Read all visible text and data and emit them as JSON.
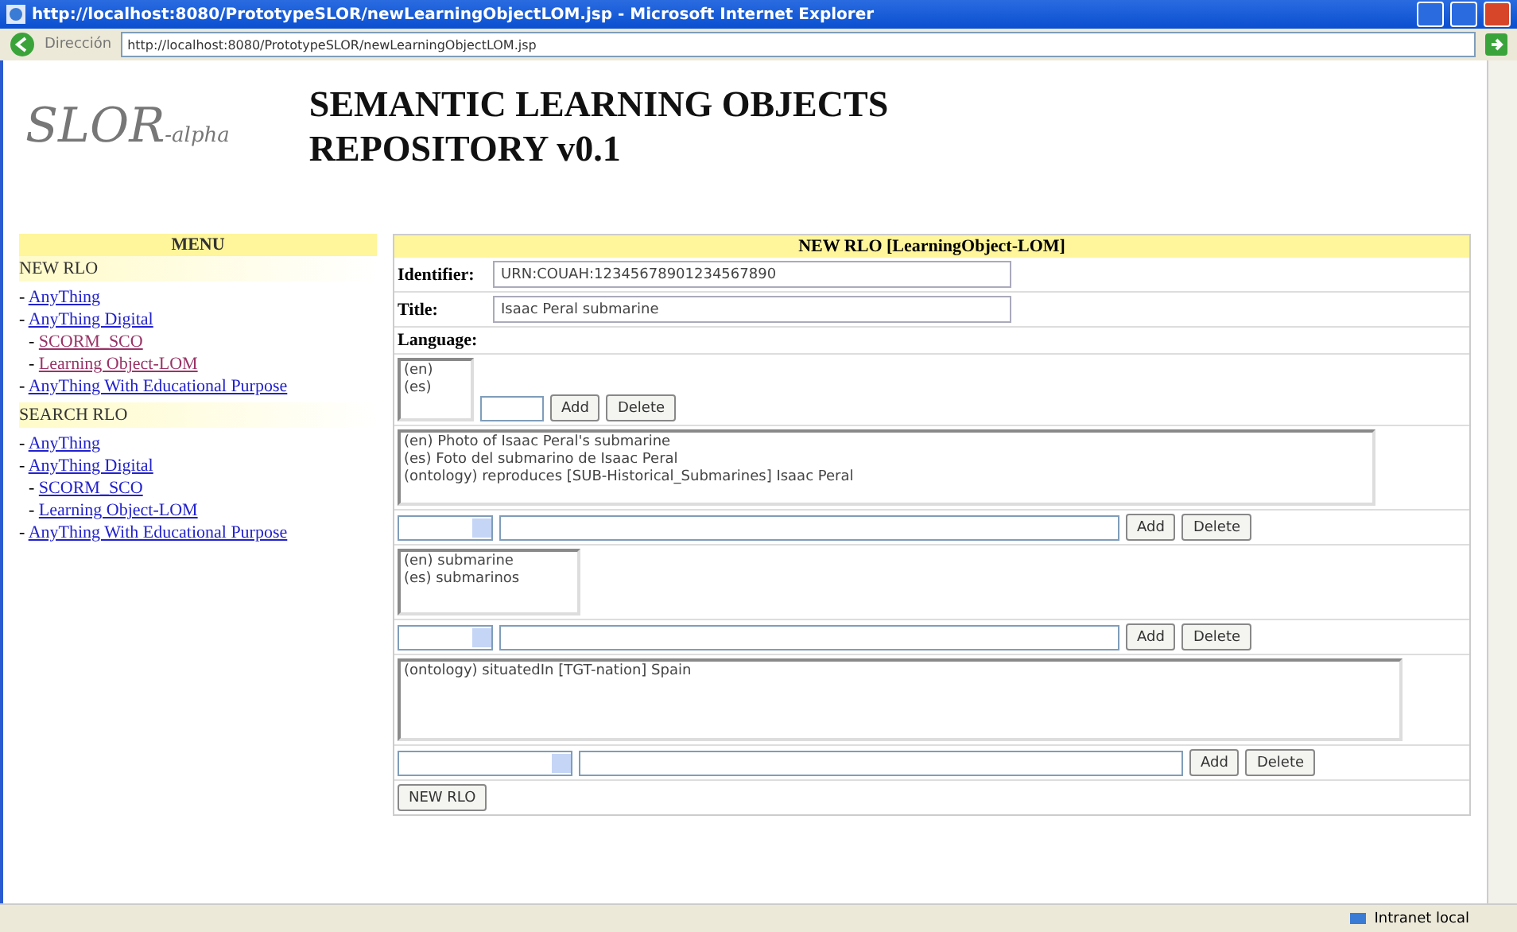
{
  "window": {
    "title": "http://localhost:8080/PrototypeSLOR/newLearningObjectLOM.jsp - Microsoft Internet Explorer"
  },
  "toolbar": {
    "address_label": "Dirección",
    "address": "http://localhost:8080/PrototypeSLOR/newLearningObjectLOM.jsp"
  },
  "logo": {
    "main": "SLOR",
    "suffix": "-alpha"
  },
  "heading": "SEMANTIC LEARNING OBJECTS REPOSITORY v0.1",
  "menu": {
    "title": "MENU",
    "sections": [
      {
        "title": "NEW RLO",
        "links": [
          {
            "bullet": "-",
            "label": "AnyThing",
            "visited": false
          },
          {
            "bullet": "-",
            "label": "AnyThing Digital",
            "visited": false,
            "children": [
              {
                "bullet": "-",
                "label": "SCORM_SCO",
                "visited": true
              },
              {
                "bullet": "-",
                "label": "Learning Object-LOM",
                "visited": true
              }
            ]
          },
          {
            "bullet": "-",
            "label": "AnyThing With Educational Purpose",
            "visited": false
          }
        ]
      },
      {
        "title": "SEARCH RLO",
        "links": [
          {
            "bullet": "-",
            "label": "AnyThing",
            "visited": false
          },
          {
            "bullet": "-",
            "label": "AnyThing Digital",
            "visited": false,
            "children": [
              {
                "bullet": "-",
                "label": "SCORM_SCO",
                "visited": false
              },
              {
                "bullet": "-",
                "label": "Learning Object-LOM",
                "visited": false
              }
            ]
          },
          {
            "bullet": "-",
            "label": "AnyThing With Educational Purpose",
            "visited": false
          }
        ]
      }
    ]
  },
  "form": {
    "title": "NEW RLO [LearningObject-LOM]",
    "fields": [
      {
        "label": "Identifier:",
        "value": "URN:COUAH:12345678901234567890"
      },
      {
        "label": "Title:",
        "value": "Isaac Peral submarine"
      }
    ],
    "language_label": "Language:",
    "lists": [
      {
        "kind": "language",
        "items": [
          "(en)",
          "(es)"
        ],
        "buttons": [
          "Add",
          "Delete"
        ]
      },
      {
        "kind": "wide",
        "items": [
          "(en) Photo of Isaac Peral's submarine",
          "(es) Foto del submarino de Isaac Peral",
          "(ontology) reproduces [SUB-Historical_Submarines] Isaac Peral"
        ],
        "buttons": [
          "Add",
          "Delete"
        ]
      },
      {
        "kind": "narrow",
        "items": [
          "(en) submarine",
          "(es) submarinos"
        ],
        "buttons": [
          "Add",
          "Delete"
        ]
      },
      {
        "kind": "wider",
        "items": [
          "(ontology) situatedIn [TGT-nation] Spain"
        ],
        "buttons": [
          "Add",
          "Delete"
        ]
      }
    ],
    "submit": "NEW RLO"
  },
  "status_bar": {
    "zone": "Intranet local"
  }
}
